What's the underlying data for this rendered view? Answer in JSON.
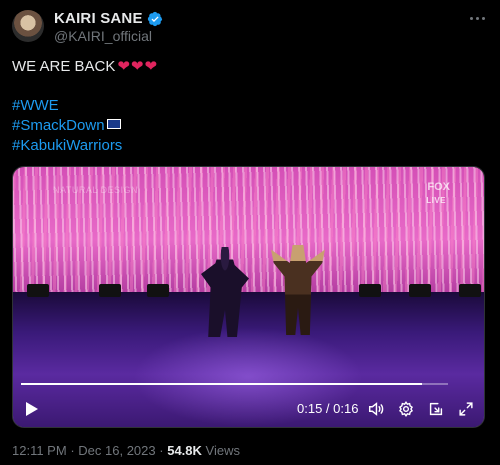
{
  "author": {
    "display_name": "KAIRI SANE",
    "handle": "@KAIRI_official",
    "verified": true
  },
  "tweet": {
    "text": "WE ARE BACK",
    "hearts": "❤❤❤",
    "hashtags": [
      "#WWE",
      "#SmackDown",
      "#KabukiWarriors"
    ]
  },
  "video": {
    "watermark": "NATURAL DESIGN",
    "network_logo": "FOX",
    "live_label": "LIVE",
    "time_display": "0:15 / 0:16",
    "progress": 0.94
  },
  "meta": {
    "time": "12:11 PM",
    "separator": "·",
    "date": "Dec 16, 2023",
    "views_count": "54.8K",
    "views_label": "Views"
  },
  "colors": {
    "link": "#1d9bf0",
    "secondary_text": "#71767b",
    "heart": "#e0245e",
    "verified_badge": "#1d9bf0"
  }
}
